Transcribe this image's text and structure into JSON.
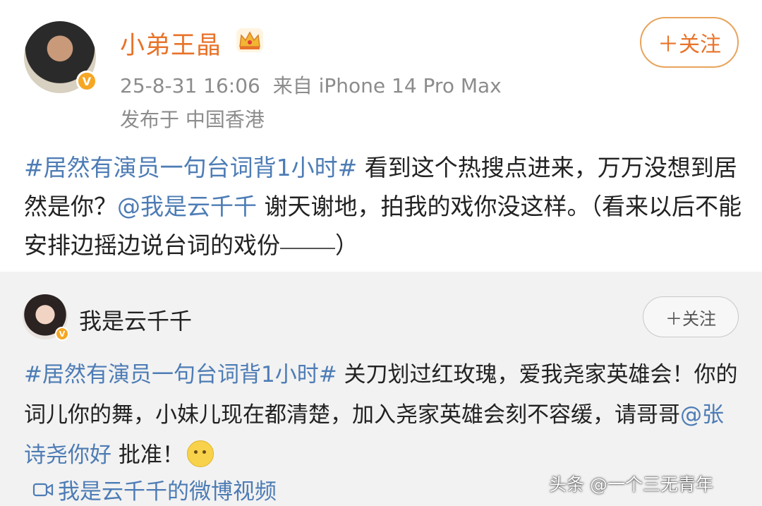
{
  "post": {
    "username": "小弟王晶",
    "follow_label": "＋关注",
    "timestamp": "25-8-31 16:06",
    "source": "来自 iPhone 14 Pro Max",
    "location": "发布于 中国香港",
    "hashtag": "#居然有演员一句台词背1小时#",
    "text_part1": " 看到这个热搜点进来，万万没想到居然是你？",
    "mention": "@我是云千千",
    "text_part2": " 谢天谢地，拍我的戏你没这样。（看来以后不能安排边摇边说台词的戏份",
    "text_end": "）"
  },
  "repost": {
    "username": "我是云千千",
    "follow_label": "＋关注",
    "hashtag": "#居然有演员一句台词背1小时#",
    "text_part1": " 关刀划过红玫瑰，爱我尧家英雄会！你的词儿你的舞，小妹儿现在都清楚，加入尧家英雄会刻不容缓，请哥哥",
    "mention": "@张诗尧你好",
    "text_part2": " 批准！",
    "video_link": "我是云千千的微博视频"
  },
  "watermark": "头条 @一个三无青年",
  "colors": {
    "username_orange": "#e8732a",
    "link_blue": "#4d7cb5",
    "verified_gold": "#f5a623",
    "repost_bg": "#f2f2f2"
  },
  "icons": [
    "crown-icon",
    "verified-icon",
    "video-camera-icon",
    "emoji-icon"
  ]
}
